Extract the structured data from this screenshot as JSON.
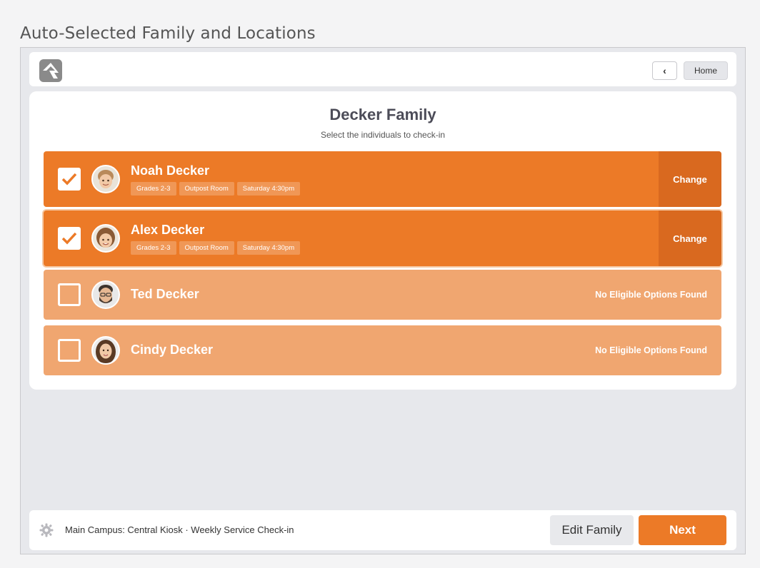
{
  "caption": "Auto-Selected Family and Locations",
  "header": {
    "back_label": "‹",
    "home_label": "Home"
  },
  "family": {
    "title": "Decker Family",
    "subtitle": "Select the individuals to check-in",
    "people": [
      {
        "name": "Noah Decker",
        "checked": true,
        "tags": [
          "Grades 2-3",
          "Outpost Room",
          "Saturday 4:30pm"
        ],
        "action": "Change"
      },
      {
        "name": "Alex Decker",
        "checked": true,
        "tags": [
          "Grades 2-3",
          "Outpost Room",
          "Saturday 4:30pm"
        ],
        "action": "Change"
      },
      {
        "name": "Ted Decker",
        "checked": false,
        "status": "No Eligible Options Found"
      },
      {
        "name": "Cindy Decker",
        "checked": false,
        "status": "No Eligible Options Found"
      }
    ]
  },
  "footer": {
    "location": "Main Campus: Central Kiosk · Weekly Service Check-in",
    "edit_family_label": "Edit Family",
    "next_label": "Next"
  },
  "colors": {
    "accent": "#ec7a27",
    "accent_dark": "#d9691f",
    "disabled_row": "#f0a670"
  }
}
